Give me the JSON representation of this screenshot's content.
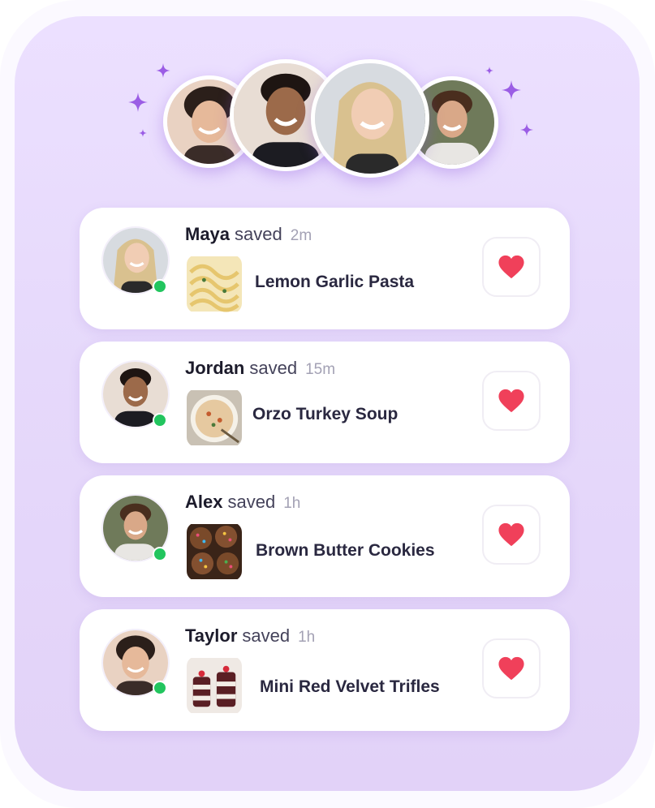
{
  "friends_group": {
    "avatars": [
      {
        "name": "taylor-avatar"
      },
      {
        "name": "jordan-avatar"
      },
      {
        "name": "maya-avatar"
      },
      {
        "name": "alex-avatar"
      }
    ]
  },
  "feed": {
    "items": [
      {
        "user": "Maya",
        "action": "saved",
        "time": "2m",
        "recipe": "Lemon Garlic Pasta",
        "online": true,
        "liked": true
      },
      {
        "user": "Jordan",
        "action": "saved",
        "time": "15m",
        "recipe": "Orzo Turkey Soup",
        "online": true,
        "liked": true
      },
      {
        "user": "Alex",
        "action": "saved",
        "time": "1h",
        "recipe": "Brown Butter Cookies",
        "online": true,
        "liked": true
      },
      {
        "user": "Taylor",
        "action": "saved",
        "time": "1h",
        "recipe": "Mini Red Velvet Trifles",
        "online": true,
        "liked": true
      }
    ]
  },
  "colors": {
    "card_background": "#e8dcfc",
    "accent_sparkle": "#9b5de5",
    "heart": "#f0405a",
    "online": "#22c55e"
  },
  "icons": [
    "sparkle-icon",
    "heart-icon",
    "online-status-icon"
  ]
}
